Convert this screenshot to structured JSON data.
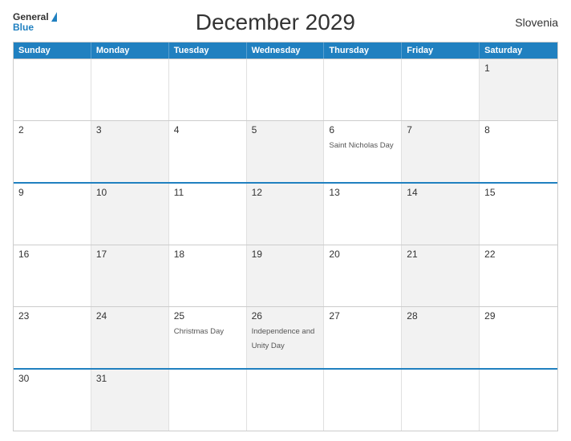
{
  "header": {
    "title": "December 2029",
    "country": "Slovenia",
    "logo_general": "General",
    "logo_blue": "Blue"
  },
  "days_of_week": [
    "Sunday",
    "Monday",
    "Tuesday",
    "Wednesday",
    "Thursday",
    "Friday",
    "Saturday"
  ],
  "weeks": [
    {
      "highlight": false,
      "days": [
        {
          "number": "",
          "event": "",
          "grey": false
        },
        {
          "number": "",
          "event": "",
          "grey": false
        },
        {
          "number": "",
          "event": "",
          "grey": false
        },
        {
          "number": "",
          "event": "",
          "grey": false
        },
        {
          "number": "",
          "event": "",
          "grey": false
        },
        {
          "number": "",
          "event": "",
          "grey": false
        },
        {
          "number": "1",
          "event": "",
          "grey": true
        }
      ]
    },
    {
      "highlight": false,
      "days": [
        {
          "number": "2",
          "event": "",
          "grey": false
        },
        {
          "number": "3",
          "event": "",
          "grey": true
        },
        {
          "number": "4",
          "event": "",
          "grey": false
        },
        {
          "number": "5",
          "event": "",
          "grey": true
        },
        {
          "number": "6",
          "event": "Saint Nicholas Day",
          "grey": false
        },
        {
          "number": "7",
          "event": "",
          "grey": true
        },
        {
          "number": "8",
          "event": "",
          "grey": false
        }
      ]
    },
    {
      "highlight": true,
      "days": [
        {
          "number": "9",
          "event": "",
          "grey": false
        },
        {
          "number": "10",
          "event": "",
          "grey": true
        },
        {
          "number": "11",
          "event": "",
          "grey": false
        },
        {
          "number": "12",
          "event": "",
          "grey": true
        },
        {
          "number": "13",
          "event": "",
          "grey": false
        },
        {
          "number": "14",
          "event": "",
          "grey": true
        },
        {
          "number": "15",
          "event": "",
          "grey": false
        }
      ]
    },
    {
      "highlight": false,
      "days": [
        {
          "number": "16",
          "event": "",
          "grey": false
        },
        {
          "number": "17",
          "event": "",
          "grey": true
        },
        {
          "number": "18",
          "event": "",
          "grey": false
        },
        {
          "number": "19",
          "event": "",
          "grey": true
        },
        {
          "number": "20",
          "event": "",
          "grey": false
        },
        {
          "number": "21",
          "event": "",
          "grey": true
        },
        {
          "number": "22",
          "event": "",
          "grey": false
        }
      ]
    },
    {
      "highlight": false,
      "days": [
        {
          "number": "23",
          "event": "",
          "grey": false
        },
        {
          "number": "24",
          "event": "",
          "grey": true
        },
        {
          "number": "25",
          "event": "Christmas Day",
          "grey": false
        },
        {
          "number": "26",
          "event": "Independence and Unity Day",
          "grey": true
        },
        {
          "number": "27",
          "event": "",
          "grey": false
        },
        {
          "number": "28",
          "event": "",
          "grey": true
        },
        {
          "number": "29",
          "event": "",
          "grey": false
        }
      ]
    },
    {
      "highlight": true,
      "days": [
        {
          "number": "30",
          "event": "",
          "grey": false
        },
        {
          "number": "31",
          "event": "",
          "grey": true
        },
        {
          "number": "",
          "event": "",
          "grey": false
        },
        {
          "number": "",
          "event": "",
          "grey": false
        },
        {
          "number": "",
          "event": "",
          "grey": false
        },
        {
          "number": "",
          "event": "",
          "grey": false
        },
        {
          "number": "",
          "event": "",
          "grey": false
        }
      ]
    }
  ]
}
